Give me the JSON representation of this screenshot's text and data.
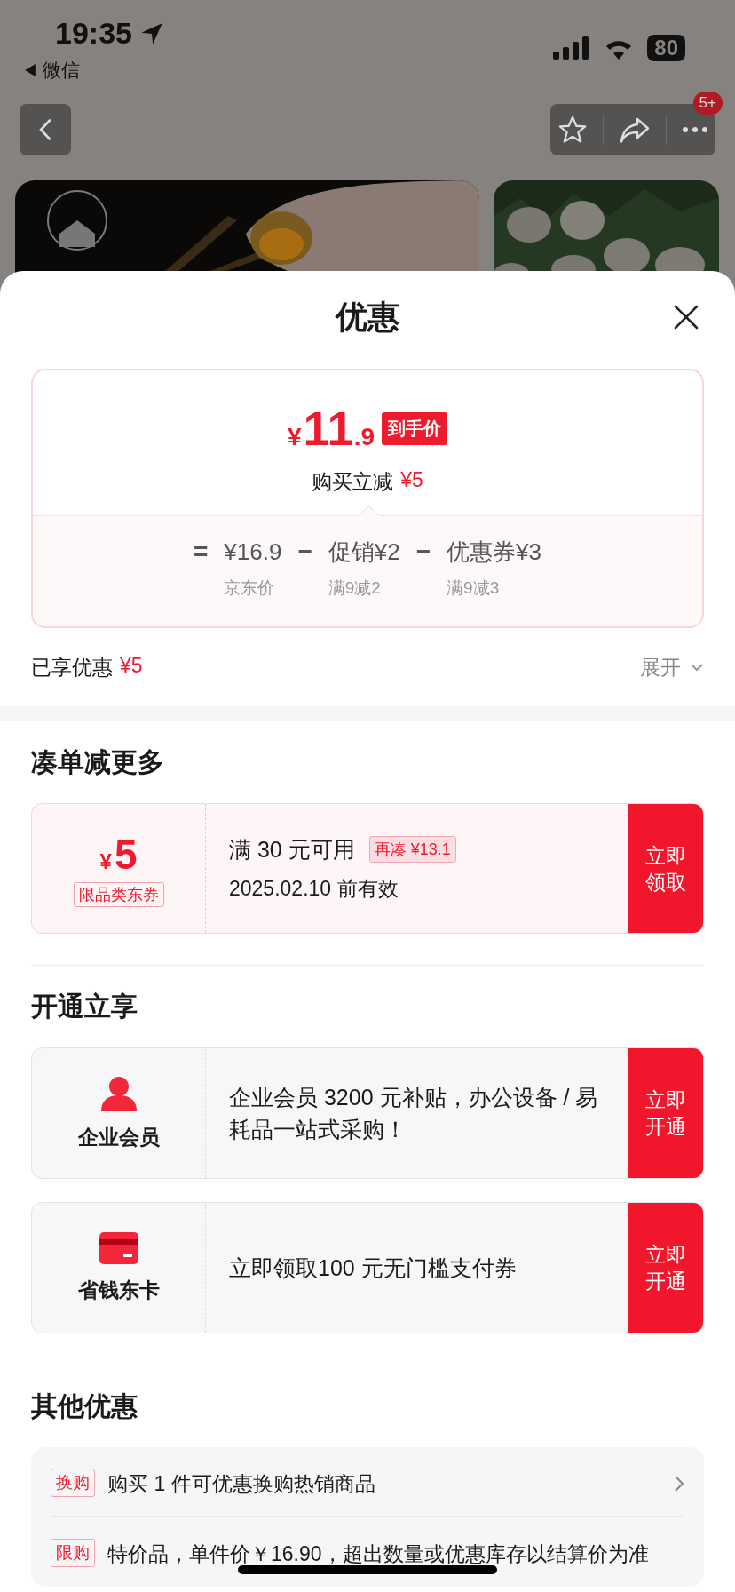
{
  "status_bar": {
    "time": "19:35",
    "back_app": "微信",
    "battery": "80"
  },
  "nav": {
    "badge": "5+"
  },
  "sheet": {
    "title": "优惠",
    "price_card": {
      "currency": "¥",
      "integer": "11",
      "decimal": ".9",
      "badge": "到手价",
      "discount_label": "购买立减",
      "discount_amount": "¥5",
      "formula": [
        {
          "op": "=",
          "amount": "¥16.9",
          "note": "京东价"
        },
        {
          "op": "−",
          "label": "促销",
          "amount": "¥2",
          "note": "满9减2"
        },
        {
          "op": "−",
          "label": "优惠券",
          "amount": "¥3",
          "note": "满9减3"
        }
      ]
    },
    "enjoyed": {
      "label": "已享优惠",
      "amount": "¥5",
      "expand": "展开"
    },
    "coupon_section": {
      "title": "凑单减更多",
      "coupons": [
        {
          "currency": "¥",
          "amount": "5",
          "tag": "限品类东券",
          "condition": "满 30 元可用",
          "extra": "再凑 ¥13.1",
          "validity": "2025.02.10 前有效",
          "action": "立即领取"
        }
      ]
    },
    "open_section": {
      "title": "开通立享",
      "offers": [
        {
          "kind": "member",
          "name": "企业会员",
          "text": "企业会员 3200 元补贴，办公设备 / 易耗品一站式采购！",
          "action": "立即开通"
        },
        {
          "kind": "card",
          "name": "省钱东卡",
          "text": "立即领取100 元无门槛支付券",
          "action": "立即开通"
        }
      ]
    },
    "other_section": {
      "title": "其他优惠",
      "items": [
        {
          "tag": "换购",
          "text": "购买 1 件可优惠换购热销商品",
          "has_arrow": true
        },
        {
          "tag": "限购",
          "text": "特价品，单件价￥16.90，超出数量或优惠库存以结算价为准",
          "has_arrow": false
        }
      ]
    }
  }
}
